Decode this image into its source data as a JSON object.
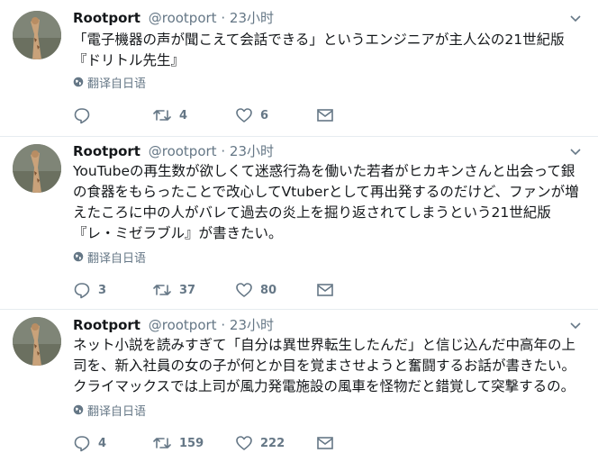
{
  "tweets": [
    {
      "name": "Rootport",
      "handle": "@rootport",
      "separator": "·",
      "time": "23小时",
      "text": "「電子機器の声が聞こえて会話できる」というエンジニアが主人公の21世紀版\n『ドリトル先生』",
      "translate": "翻译自日语",
      "replies": "",
      "retweets": "4",
      "likes": "6"
    },
    {
      "name": "Rootport",
      "handle": "@rootport",
      "separator": "·",
      "time": "23小时",
      "text": "YouTubeの再生数が欲しくて迷惑行為を働いた若者がヒカキンさんと出会って銀\nの食器をもらったことで改心してVtuberとして再出発するのだけど、ファンが増\nえたころに中の人がバレて過去の炎上を掘り返されてしまうという21世紀版\n『レ・ミゼラブル』が書きたい。",
      "translate": "翻译自日语",
      "replies": "3",
      "retweets": "37",
      "likes": "80"
    },
    {
      "name": "Rootport",
      "handle": "@rootport",
      "separator": "·",
      "time": "23小时",
      "text": "ネット小説を読みすぎて「自分は異世界転生したんだ」と信じ込んだ中高年の上\n司を、新入社員の女の子が何とか目を覚まさせようと奮闘するお話が書きたい。\nクライマックスでは上司が風力発電施設の風車を怪物だと錯覚して突撃するの。",
      "translate": "翻译自日语",
      "replies": "4",
      "retweets": "159",
      "likes": "222"
    }
  ],
  "icons": {
    "more": "chevron-down-icon",
    "translate": "globe-icon",
    "reply": "reply-icon",
    "retweet": "retweet-icon",
    "like": "heart-icon",
    "message": "envelope-icon"
  },
  "colors": {
    "text": "#14171a",
    "secondary": "#657786",
    "border": "#e6ecf0"
  }
}
